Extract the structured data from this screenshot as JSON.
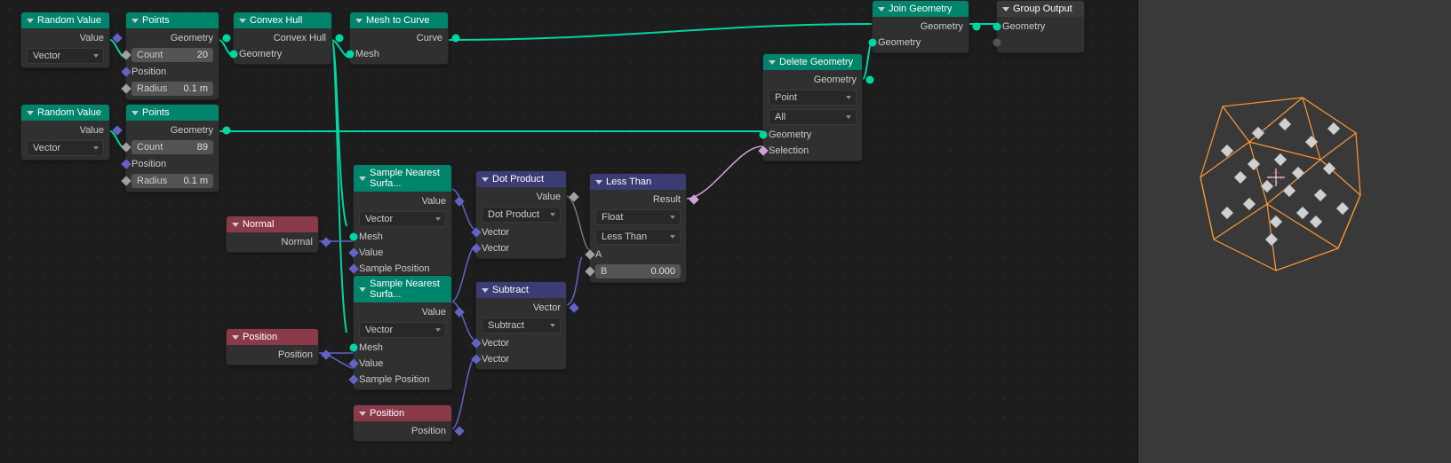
{
  "nodes": {
    "random1": {
      "title": "Random Value",
      "out_value": "Value",
      "type_select": "Vector"
    },
    "random2": {
      "title": "Random Value",
      "out_value": "Value",
      "type_select": "Vector"
    },
    "points1": {
      "title": "Points",
      "out": "Geometry",
      "count_lbl": "Count",
      "count_val": "20",
      "position": "Position",
      "radius_lbl": "Radius",
      "radius_val": "0.1 m"
    },
    "points2": {
      "title": "Points",
      "out": "Geometry",
      "count_lbl": "Count",
      "count_val": "89",
      "position": "Position",
      "radius_lbl": "Radius",
      "radius_val": "0.1 m"
    },
    "convex": {
      "title": "Convex Hull",
      "out": "Convex Hull",
      "in": "Geometry"
    },
    "m2c": {
      "title": "Mesh to Curve",
      "out": "Curve",
      "in": "Mesh"
    },
    "sns1": {
      "title": "Sample Nearest Surfa...",
      "out_value": "Value",
      "type_select": "Vector",
      "mesh": "Mesh",
      "value": "Value",
      "sample_pos": "Sample Position"
    },
    "sns2": {
      "title": "Sample Nearest Surfa...",
      "out_value": "Value",
      "type_select": "Vector",
      "mesh": "Mesh",
      "value": "Value",
      "sample_pos": "Sample Position"
    },
    "normal": {
      "title": "Normal",
      "out": "Normal"
    },
    "position": {
      "title": "Position",
      "out": "Position"
    },
    "position2": {
      "title": "Position",
      "out": "Position"
    },
    "dot": {
      "title": "Dot Product",
      "out": "Value",
      "op": "Dot Product",
      "v1": "Vector",
      "v2": "Vector"
    },
    "subtract": {
      "title": "Subtract",
      "out": "Vector",
      "op": "Subtract",
      "v1": "Vector",
      "v2": "Vector"
    },
    "less": {
      "title": "Less Than",
      "out": "Result",
      "mode1": "Float",
      "mode2": "Less Than",
      "a": "A",
      "b_lbl": "B",
      "b_val": "0.000"
    },
    "delgeo": {
      "title": "Delete Geometry",
      "out": "Geometry",
      "mode1": "Point",
      "mode2": "All",
      "in_geom": "Geometry",
      "in_sel": "Selection"
    },
    "join": {
      "title": "Join Geometry",
      "out": "Geometry",
      "in": "Geometry"
    },
    "groupout": {
      "title": "Group Output",
      "in": "Geometry"
    }
  }
}
